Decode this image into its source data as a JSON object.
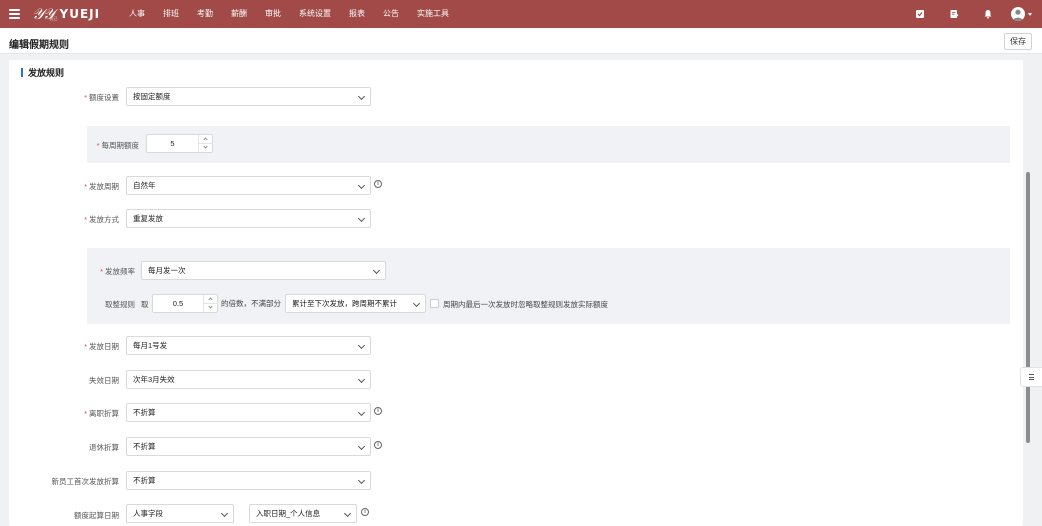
{
  "app": {
    "logo_text": "YUEJI",
    "logo_sub": "悦己",
    "nav": [
      "人事",
      "排班",
      "考勤",
      "薪酬",
      "审批",
      "系统设置",
      "报表",
      "公告",
      "实施工具"
    ],
    "icons": [
      "menu-icon",
      "checklist-icon",
      "document-edit-icon",
      "bell-icon",
      "user-avatar-icon",
      "chevron-down-icon"
    ],
    "brand_color": "#a14a47"
  },
  "page": {
    "title": "编辑假期规则",
    "save_label": "保存"
  },
  "section": {
    "title": "发放规则"
  },
  "form": {
    "quota_setting": {
      "label": "额度设置",
      "value": "按固定额度",
      "required": true
    },
    "per_cycle_quota": {
      "label": "每周期额度",
      "value": "5",
      "required": true
    },
    "cycle": {
      "label": "发放周期",
      "value": "自然年",
      "required": true
    },
    "method": {
      "label": "发放方式",
      "value": "重复发放",
      "required": true
    },
    "frequency": {
      "label": "发放频率",
      "value": "每月发一次",
      "required": true
    },
    "rounding": {
      "label": "取整规则",
      "prefix": "取",
      "multiple": "0.5",
      "suffix": "的倍数，不满部分",
      "mode": "累计至下次发放，跨周期不累计",
      "checkbox_label": "周期内最后一次发放时忽略取整规则发放实际额度"
    },
    "issue_date": {
      "label": "发放日期",
      "value": "每月1号发",
      "required": true
    },
    "expire_date": {
      "label": "失效日期",
      "value": "次年3月失效",
      "required": false
    },
    "leave_prorate": {
      "label": "离职折算",
      "value": "不折算",
      "required": true
    },
    "retire_prorate": {
      "label": "退休折算",
      "value": "不折算",
      "required": false
    },
    "newhire_prorate": {
      "label": "新员工首次发放折算",
      "value": "不折算",
      "required": false
    },
    "quota_start": {
      "label": "额度起算日期",
      "field_type": "人事字段",
      "field": "入职日期_个人信息",
      "required": false
    }
  }
}
